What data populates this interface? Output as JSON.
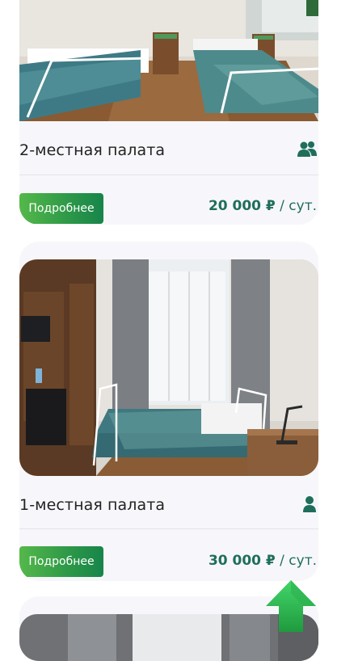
{
  "rooms": [
    {
      "title": "2-местная палата",
      "occupancy_icon": "two-people-icon",
      "more_label": "Подробнее",
      "price_amount": "20 000 ₽",
      "price_unit": " / сут."
    },
    {
      "title": "1-местная палата",
      "occupancy_icon": "person-icon",
      "more_label": "Подробнее",
      "price_amount": "30 000 ₽",
      "price_unit": " / сут."
    }
  ],
  "scroll_top_icon": "arrow-up-icon",
  "colors": {
    "button_green": "#2f9a48",
    "price_teal": "#1f6e5b",
    "card_bg": "#f7f7fb",
    "scroll_arrow_green": "#3cc85a"
  }
}
